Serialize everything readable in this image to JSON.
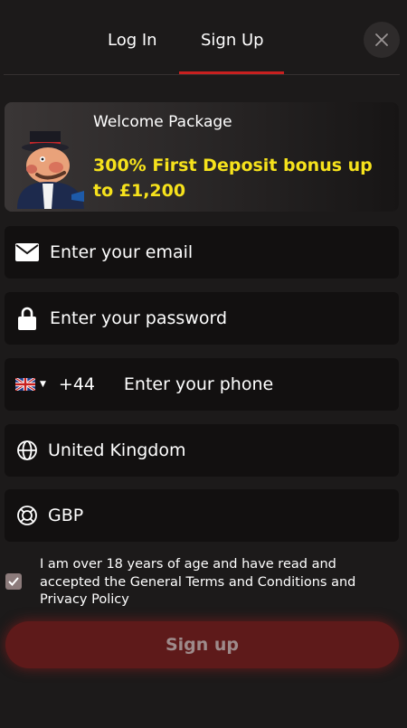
{
  "tabs": {
    "login": "Log In",
    "signup": "Sign Up",
    "active": "signup"
  },
  "promo": {
    "title": "Welcome Package",
    "offer": "300% First Deposit bonus up to £1,200"
  },
  "form": {
    "email_placeholder": "Enter your email",
    "password_placeholder": "Enter your password",
    "phone_code": "+44",
    "phone_placeholder": "Enter your phone",
    "country": "United Kingdom",
    "currency": "GBP"
  },
  "terms": {
    "checked": true,
    "text": "I am over 18 years of age and have read and accepted the General Terms and Conditions and Privacy Policy"
  },
  "signup_button": "Sign up",
  "colors": {
    "accent": "#c8201f",
    "promo_highlight": "#f6e21c",
    "button_bg": "#5e1a1a"
  }
}
